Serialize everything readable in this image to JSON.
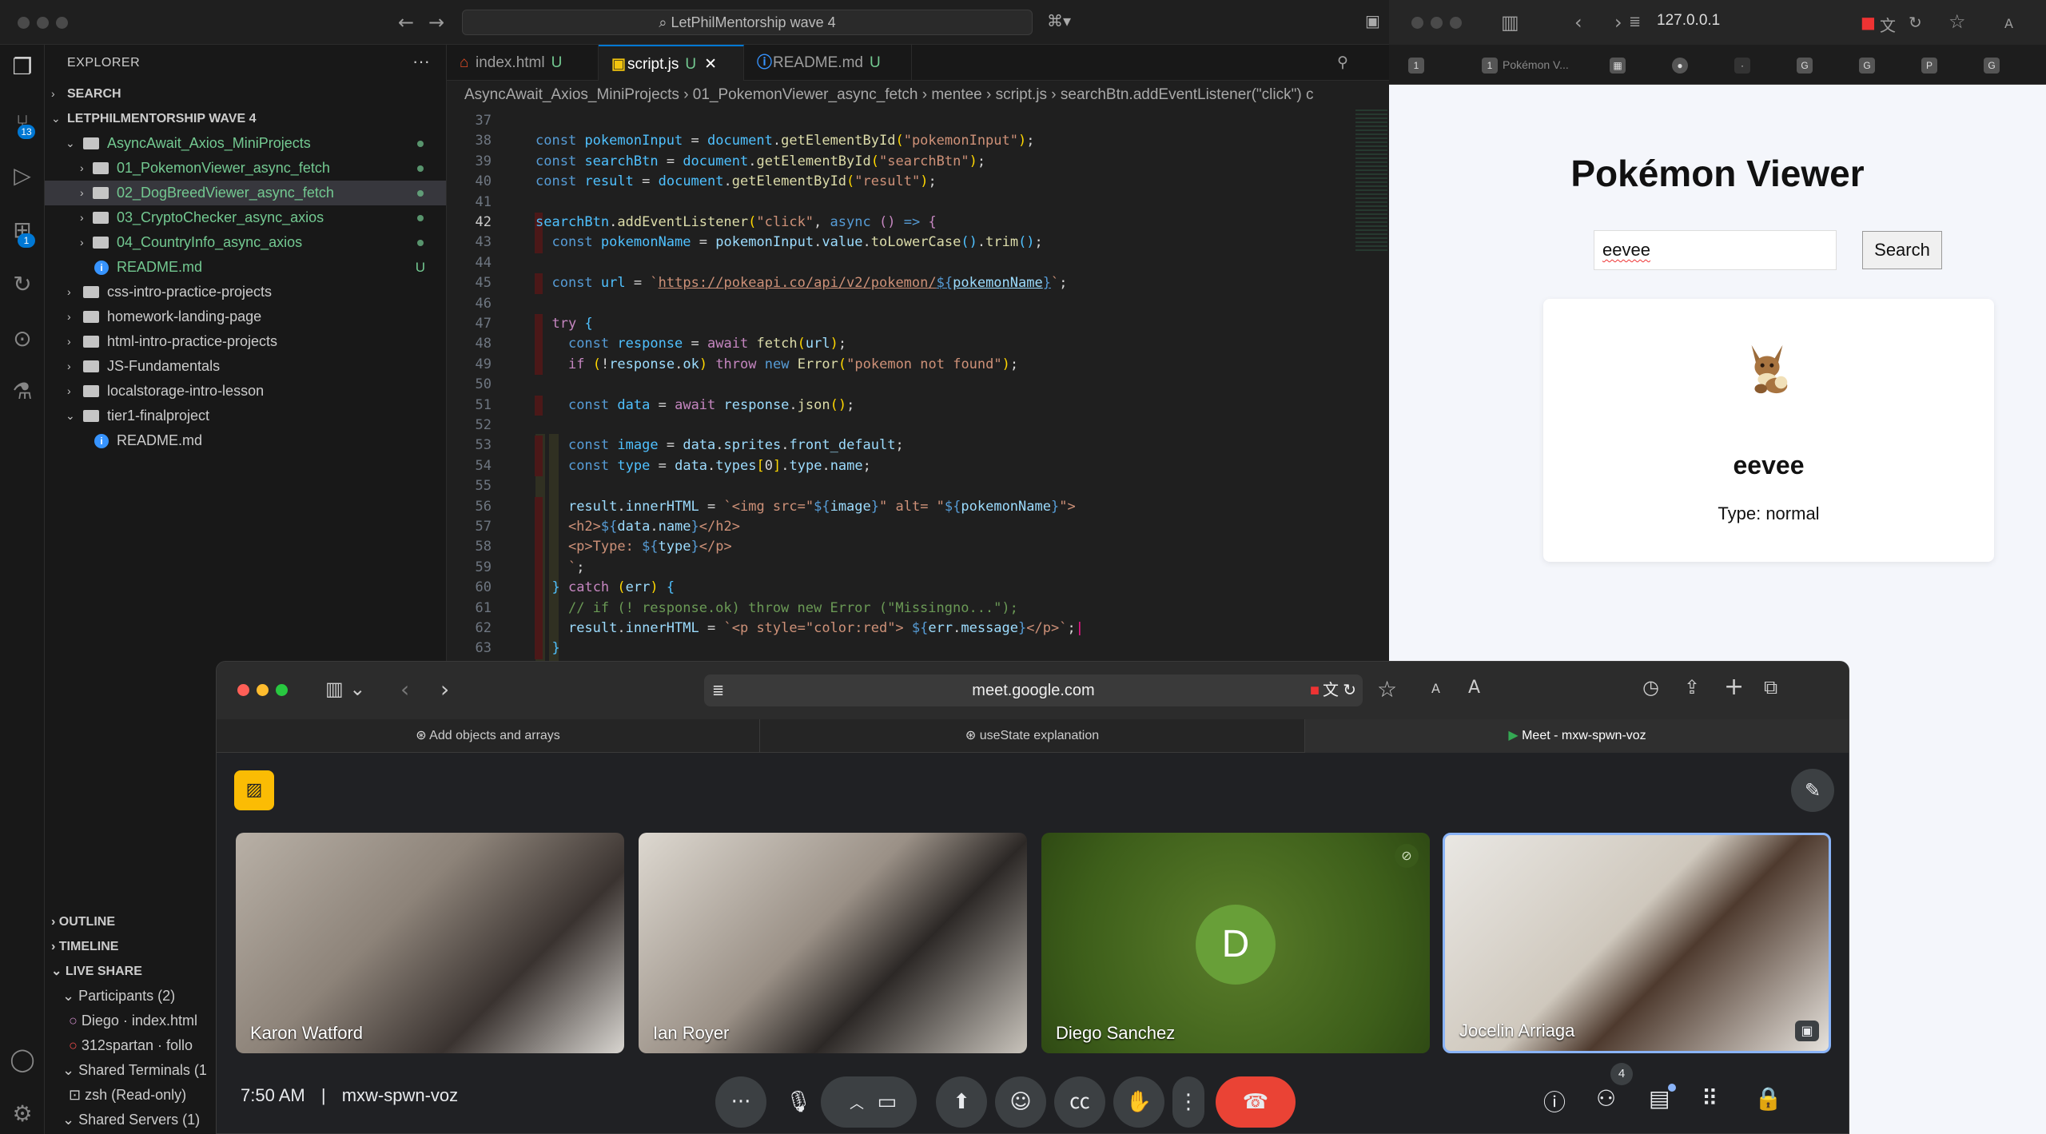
{
  "vscode": {
    "search_box": "LetPhilMentorship wave 4",
    "explorer_title": "EXPLORER",
    "section_search": "SEARCH",
    "workspace": "LETPHILMENTORSHIP WAVE 4",
    "tree": [
      {
        "label": "AsyncAwait_Axios_MiniProjects"
      },
      {
        "label": "01_PokemonViewer_async_fetch"
      },
      {
        "label": "02_DogBreedViewer_async_fetch"
      },
      {
        "label": "03_CryptoChecker_async_axios"
      },
      {
        "label": "04_CountryInfo_async_axios"
      },
      {
        "label": "README.md",
        "status": "U"
      },
      {
        "label": "css-intro-practice-projects"
      },
      {
        "label": "homework-landing-page"
      },
      {
        "label": "html-intro-practice-projects"
      },
      {
        "label": "JS-Fundamentals"
      },
      {
        "label": "localstorage-intro-lesson"
      },
      {
        "label": "tier1-finalproject"
      },
      {
        "label": "README.md"
      }
    ],
    "tabs": [
      {
        "label": "index.html",
        "status": "U"
      },
      {
        "label": "script.js",
        "status": "U"
      },
      {
        "label": "README.md",
        "status": "U"
      }
    ],
    "breadcrumb": "AsyncAwait_Axios_MiniProjects  ›  01_PokemonViewer_async_fetch  ›  mentee  ›  script.js  ›  searchBtn.addEventListener(\"click\") c",
    "badge_source_control": "13",
    "badge_extensions": "1",
    "line_numbers": [
      "37",
      "38",
      "39",
      "40",
      "41",
      "42",
      "43",
      "44",
      "45",
      "46",
      "47",
      "48",
      "49",
      "50",
      "51",
      "52",
      "53",
      "54",
      "55",
      "56",
      "57",
      "58",
      "59",
      "60",
      "61",
      "62",
      "63"
    ],
    "panels": {
      "outline": "OUTLINE",
      "timeline": "TIMELINE",
      "live_share": "LIVE SHARE",
      "participants": "Participants (2)",
      "p1": "Diego  ·  index.html",
      "p2": "312spartan  ·  follo",
      "shared_terminals": "Shared Terminals (1",
      "zsh": "zsh (Read-only)",
      "shared_servers": "Shared Servers (1)"
    }
  },
  "browser": {
    "url": "127.0.0.1",
    "tab_label": "Pokémon V...",
    "tab_count_1": "1",
    "tab_count_2": "1",
    "title": "Pokémon Viewer",
    "input_value": "eevee",
    "search_label": "Search",
    "result_name": "eevee",
    "result_type": "Type: normal"
  },
  "meet": {
    "url": "meet.google.com",
    "tabs": [
      {
        "label": "Add objects and arrays"
      },
      {
        "label": "useState explanation"
      },
      {
        "label": "Meet - mxw-spwn-voz"
      }
    ],
    "participants": [
      {
        "name": "Karon Watford"
      },
      {
        "name": "Ian Royer"
      },
      {
        "name": "Diego Sanchez",
        "initial": "D"
      },
      {
        "name": "Jocelin Arriaga"
      }
    ],
    "time": "7:50 AM",
    "separator": "|",
    "meeting_code": "mxw-spwn-voz",
    "people_count": "4",
    "colors": {
      "end_call": "#ea4335",
      "tile_border": "#8ab4f8",
      "avatar": "#689f38"
    }
  }
}
